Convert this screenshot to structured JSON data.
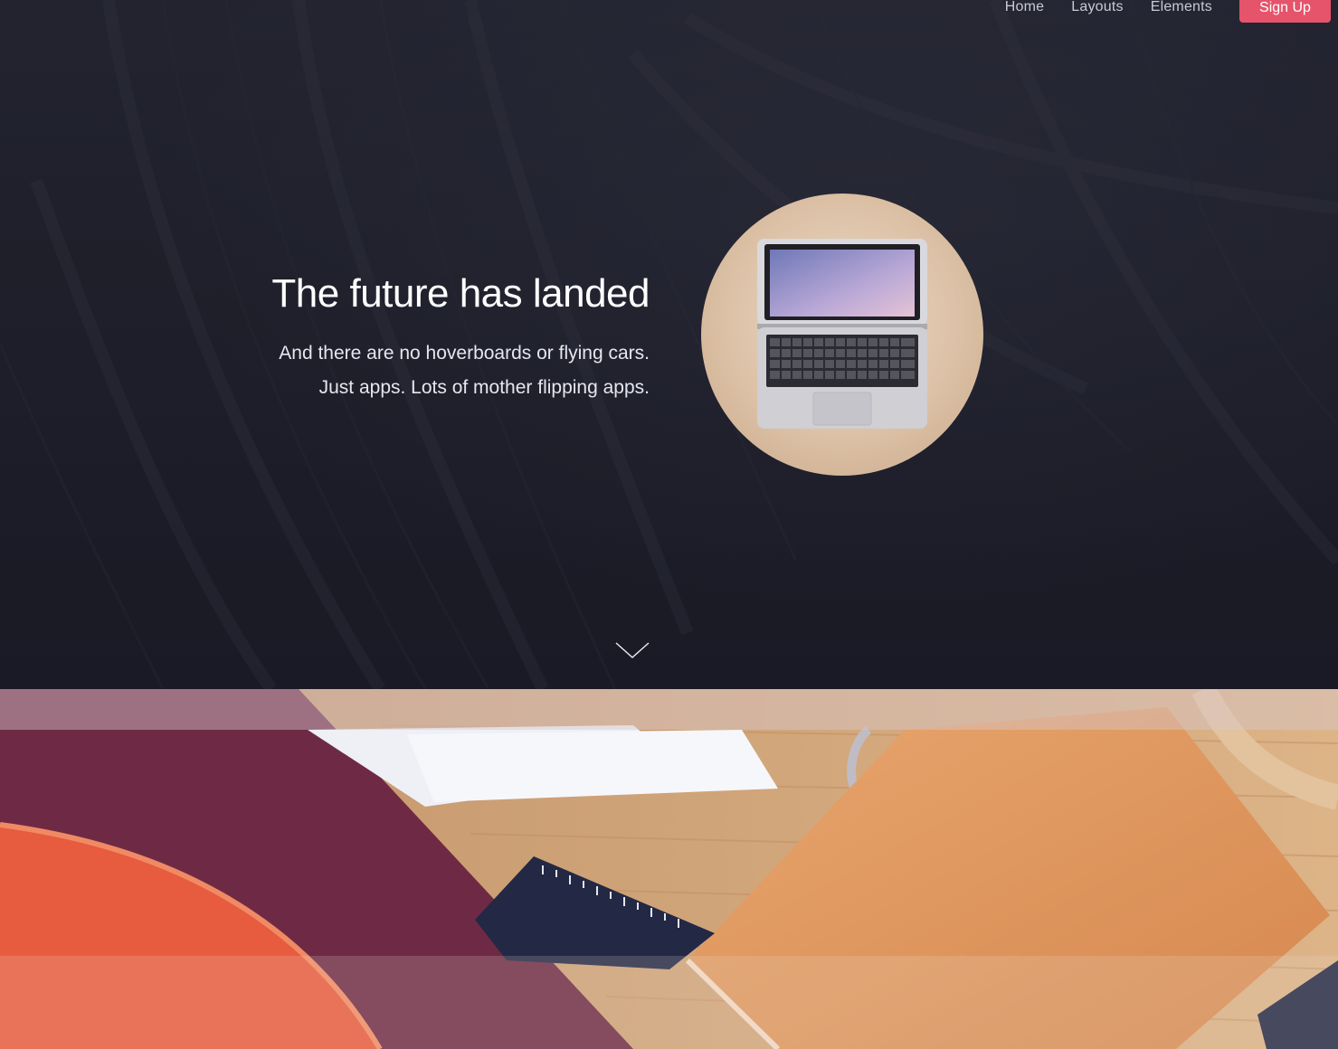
{
  "nav": {
    "links": [
      "Home",
      "Layouts",
      "Elements"
    ],
    "cta": "Sign Up",
    "cta_color": "#e5546a"
  },
  "hero": {
    "title": "The future has landed",
    "subtitle_line1": "And there are no hoverboards or flying cars.",
    "subtitle_line2": "Just apps. Lots of mother flipping apps.",
    "image": "laptop-on-desk",
    "scroll_icon": "chevron-down-icon"
  },
  "section2": {
    "image": "desk-with-notebook-and-ruler"
  }
}
